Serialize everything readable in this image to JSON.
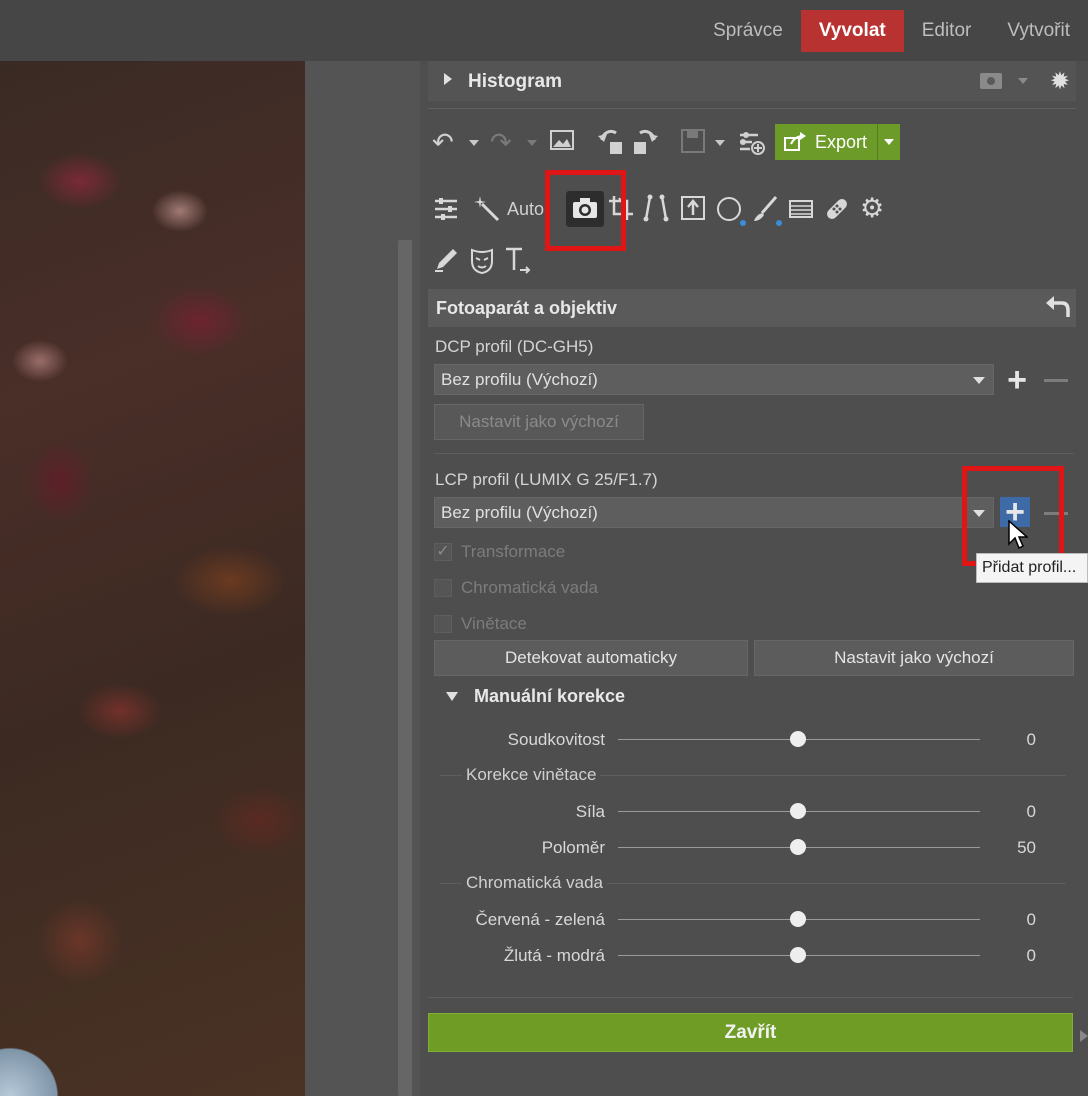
{
  "nav": {
    "items": [
      "Správce",
      "Vyvolat",
      "Editor",
      "Vytvořit"
    ],
    "active": "Vyvolat"
  },
  "histogram": {
    "title": "Histogram"
  },
  "toolbar": {
    "export_label": "Export",
    "icons": [
      "undo-icon",
      "redo-icon",
      "image-icon",
      "rotate-left-icon",
      "rotate-right-icon",
      "save-icon",
      "settings-plus-icon",
      "export-icon"
    ]
  },
  "tools": {
    "auto_label": "Auto",
    "icons": [
      "sliders-icon",
      "magic-wand-icon",
      "camera-icon",
      "crop-icon",
      "perspective-icon",
      "upright-icon",
      "radial-filter-icon",
      "brush-icon",
      "gradient-icon",
      "healing-icon",
      "settings-icon",
      "pencil-icon",
      "mask-icon",
      "text-icon"
    ]
  },
  "section": {
    "title": "Fotoaparát a objektiv",
    "dcp": {
      "label": "DCP profil (DC-GH5)",
      "value": "Bez profilu (Výchozí)",
      "set_default": "Nastavit jako výchozí"
    },
    "lcp": {
      "label": "LCP profil (LUMIX G 25/F1.7)",
      "value": "Bez profilu (Výchozí)",
      "tooltip": "Přidat profil...",
      "checks": [
        {
          "label": "Transformace",
          "checked": true
        },
        {
          "label": "Chromatická vada",
          "checked": false
        },
        {
          "label": "Vinětace",
          "checked": false
        }
      ],
      "detect_button": "Detekovat automaticky",
      "default_button": "Nastavit jako výchozí"
    }
  },
  "manual": {
    "title": "Manuální korekce",
    "distortion": {
      "label": "Soudkovitost",
      "value": "0"
    },
    "vignette_group": "Korekce vinětace",
    "vignette": [
      {
        "label": "Síla",
        "value": "0"
      },
      {
        "label": "Poloměr",
        "value": "50"
      }
    ],
    "chroma_group": "Chromatická vada",
    "chroma": [
      {
        "label": "Červená - zelená",
        "value": "0"
      },
      {
        "label": "Žlutá - modrá",
        "value": "0"
      }
    ]
  },
  "close_button": "Zavřít",
  "colors": {
    "active_tab": "#b83232",
    "export_green": "#6c9b2a",
    "close_green": "#6e9c25",
    "highlight": "#e01616",
    "plus_hover": "#3e6ba8"
  }
}
